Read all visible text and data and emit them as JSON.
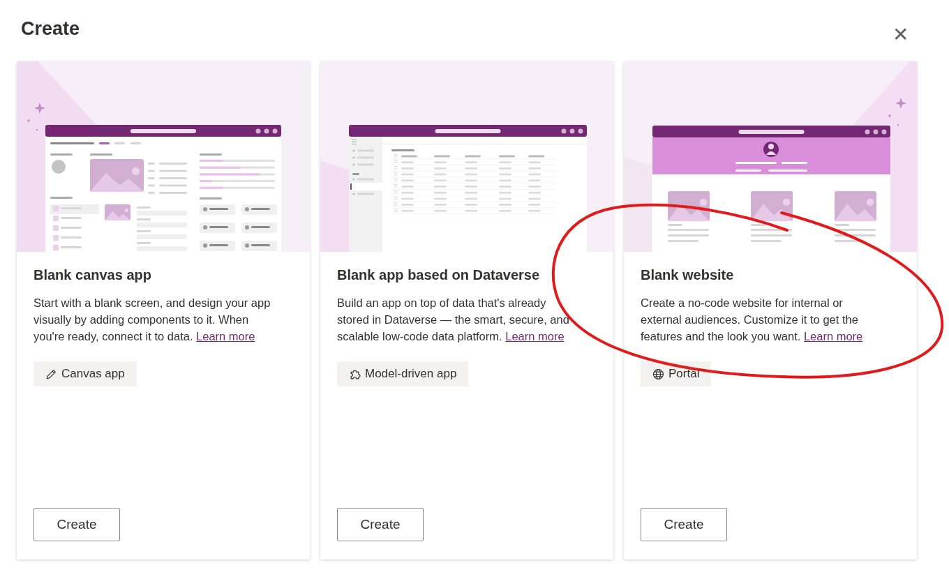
{
  "dialog": {
    "title": "Create",
    "close_label": "✕"
  },
  "cards": [
    {
      "kind": "canvas",
      "title": "Blank canvas app",
      "description": "Start with a blank screen, and design your app visually by adding components to it. When you're ready, connect it to data.",
      "link": "Learn more",
      "tag": {
        "label": "Canvas app"
      },
      "button": "Create"
    },
    {
      "kind": "model",
      "title": "Blank app based on Dataverse",
      "description": "Build an app on top of data that's already stored in Dataverse — the smart, secure, and scalable low-code data platform.",
      "link": "Learn more",
      "tag": {
        "label": "Model-driven app"
      },
      "button": "Create"
    },
    {
      "kind": "website",
      "title": "Blank website",
      "description": "Create a no-code website for internal or external audiences. Customize it to get the features and the look you want.",
      "link": "Learn more",
      "tag": {
        "label": "Portal"
      },
      "button": "Create"
    }
  ],
  "annotations": [
    {
      "kind": "loop",
      "color": "#e01b1b"
    }
  ]
}
